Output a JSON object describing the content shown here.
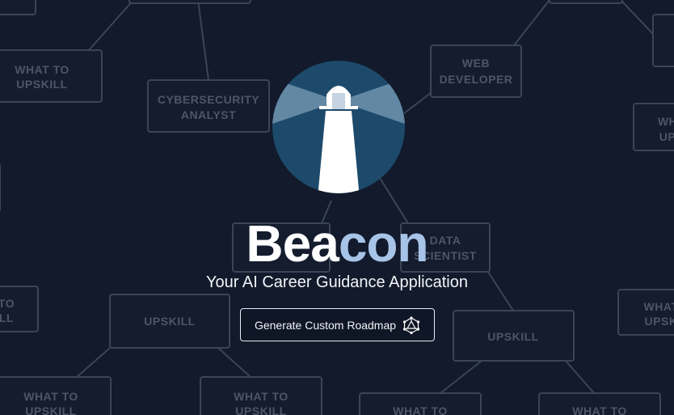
{
  "app": {
    "title_part1": "Bea",
    "title_part2": "con",
    "tagline": "Your AI Career Guidance Application",
    "cta_label": "Generate Custom Roadmap",
    "cta_icon": "graph-network-icon",
    "logo_icon": "lighthouse-icon"
  },
  "background_nodes": [
    {
      "label_lines": [
        "WHAT TO",
        "UPSKILL"
      ]
    },
    {
      "label_lines": [
        "CYBERSECURITY",
        "ANALYST"
      ]
    },
    {
      "label_lines": [
        "WEB",
        "DEVELOPER"
      ]
    },
    {
      "label_lines": [
        "DATA",
        "SCIENTIST"
      ]
    },
    {
      "label_lines": [
        "UPSKILL"
      ]
    },
    {
      "label_lines": [
        "UPSKILL"
      ]
    },
    {
      "label_lines": [
        "WHAT TO",
        "UPSKILL"
      ]
    },
    {
      "label_lines": [
        "WHAT TO",
        "UPSKILL"
      ]
    },
    {
      "label_lines": [
        "WHAT TO",
        "UPSKILL"
      ]
    },
    {
      "label_lines": [
        "WHAT TO",
        "UPSKILL"
      ]
    },
    {
      "label_lines": [
        "WH",
        "UP"
      ]
    },
    {
      "label_lines": [
        "WHAT",
        "UPSK"
      ]
    },
    {
      "label_lines": [
        "TO",
        "LL"
      ]
    },
    {
      "label_lines": [
        "UPSKILL"
      ]
    }
  ],
  "colors": {
    "background": "#121a2b",
    "logo_circle": "#1d4a6b",
    "accent": "#a7c4e8",
    "node_border": "#3b4558"
  }
}
